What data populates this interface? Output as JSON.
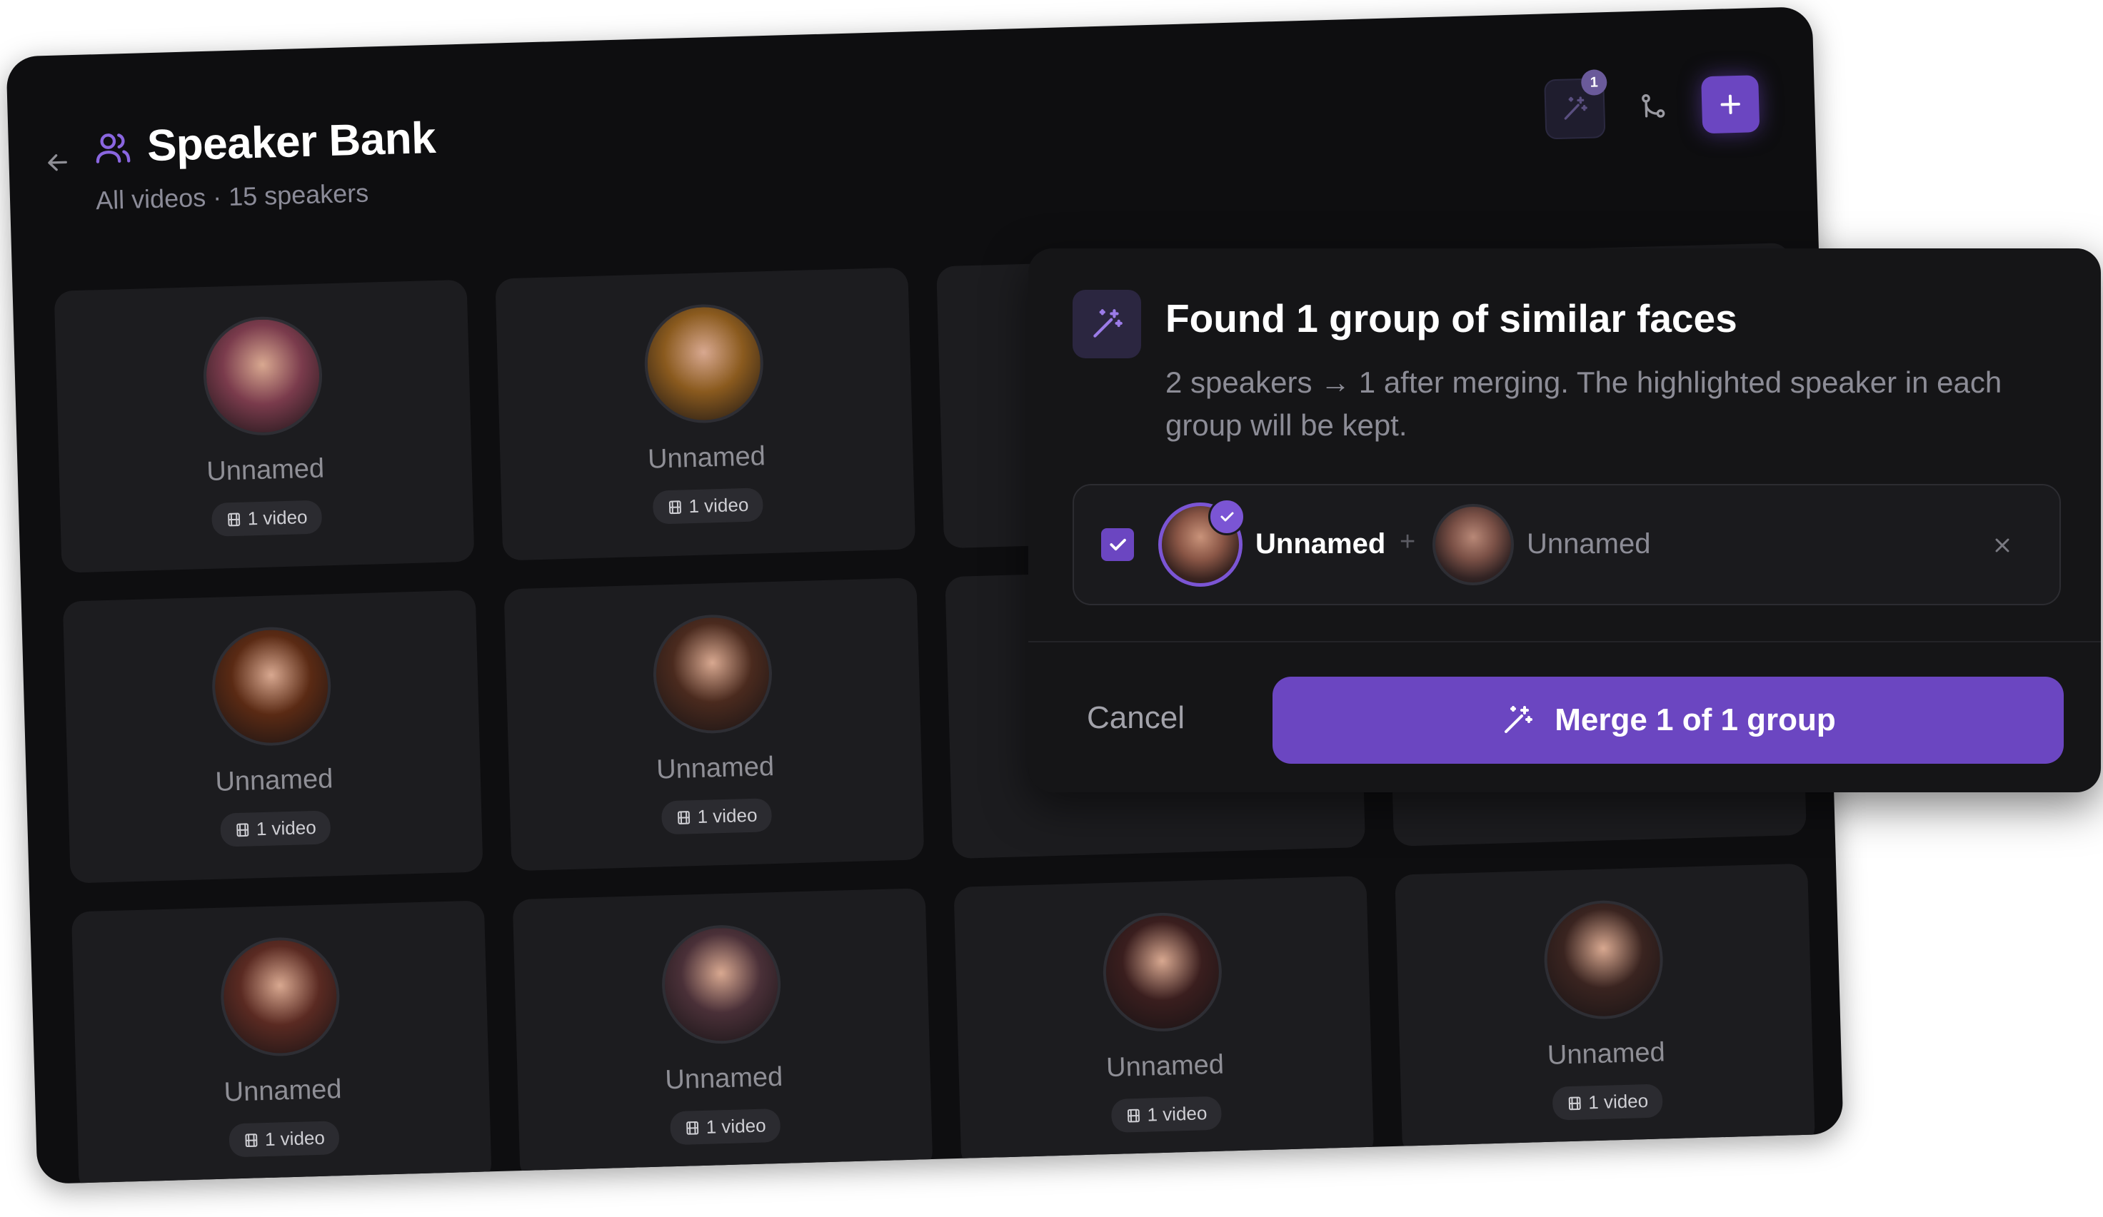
{
  "header": {
    "title": "Speaker Bank",
    "subtitle": "All videos · 15 speakers",
    "suggestions_badge": "1"
  },
  "icons": {
    "back": "arrow-left-icon",
    "title": "users-icon",
    "magic": "magic-wand-icon",
    "branch": "git-merge-icon",
    "add": "plus-icon",
    "video": "film-icon",
    "close": "close-icon",
    "check": "check-icon"
  },
  "speakers": [
    {
      "name": "Unnamed",
      "videos": "1 video",
      "color": "#7a3b4c"
    },
    {
      "name": "Unnamed",
      "videos": "1 video",
      "color": "#8a5a1e"
    },
    {
      "name": "",
      "videos": "",
      "color": "#2a2a2e"
    },
    {
      "name": "",
      "videos": "",
      "color": "#3a2a28"
    },
    {
      "name": "Unnamed",
      "videos": "1 video",
      "color": "#5a2a14"
    },
    {
      "name": "Unnamed",
      "videos": "1 video",
      "color": "#4a2a1e"
    },
    {
      "name": "",
      "videos": "",
      "color": "#2a2a2e"
    },
    {
      "name": "",
      "videos": "",
      "color": "#2a2a2e"
    },
    {
      "name": "Unnamed",
      "videos": "1 video",
      "color": "#5a2a22"
    },
    {
      "name": "Unnamed",
      "videos": "1 video",
      "color": "#4a3038"
    },
    {
      "name": "Unnamed",
      "videos": "1 video",
      "color": "#3a1e1e"
    },
    {
      "name": "Unnamed",
      "videos": "1 video",
      "color": "#3a2420"
    }
  ],
  "dialog": {
    "title": "Found 1 group of similar faces",
    "description": "2 speakers → 1 after merging. The highlighted speaker in each group will be kept.",
    "group": {
      "keep_name": "Unnamed",
      "separator": "+",
      "merge_name": "Unnamed",
      "checked": true
    },
    "cancel_label": "Cancel",
    "merge_label": "Merge 1 of 1 group"
  },
  "colors": {
    "accent": "#6b46c1",
    "background": "#0e0e10",
    "card": "#1c1c1f"
  }
}
